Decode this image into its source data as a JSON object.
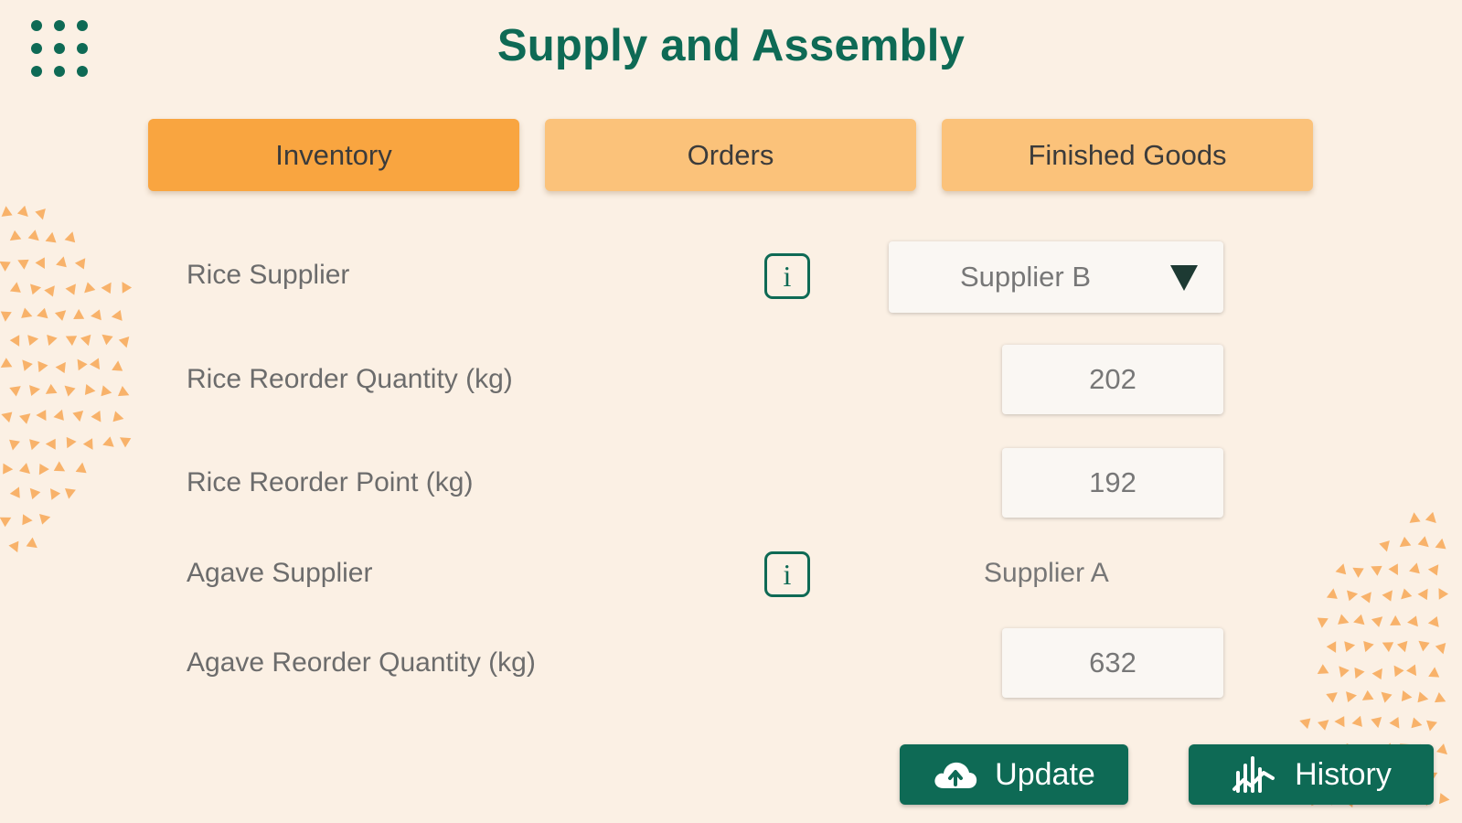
{
  "header": {
    "title": "Supply and Assembly",
    "menu_icon": "grid-dots-icon"
  },
  "tabs": [
    {
      "label": "Inventory",
      "active": true
    },
    {
      "label": "Orders",
      "active": false
    },
    {
      "label": "Finished Goods",
      "active": false
    }
  ],
  "form": {
    "rice_supplier": {
      "label": "Rice Supplier",
      "value": "Supplier B",
      "info_icon": "info-icon"
    },
    "rice_reorder_quantity": {
      "label": "Rice Reorder Quantity (kg)",
      "value": "202"
    },
    "rice_reorder_point": {
      "label": "Rice Reorder Point (kg)",
      "value": "192"
    },
    "agave_supplier": {
      "label": "Agave Supplier",
      "value": "Supplier A",
      "info_icon": "info-icon"
    },
    "agave_reorder_quantity": {
      "label": "Agave Reorder Quantity (kg)",
      "value": "632"
    }
  },
  "actions": {
    "update_label": "Update",
    "update_icon": "cloud-upload-icon",
    "history_label": "History",
    "history_icon": "chart-trend-icon"
  },
  "colors": {
    "background": "#fbf0e4",
    "primary_green": "#0e6a55",
    "tab_active": "#f9a540",
    "tab_inactive": "#fbc27a",
    "decor_orange": "#f8b26a"
  }
}
